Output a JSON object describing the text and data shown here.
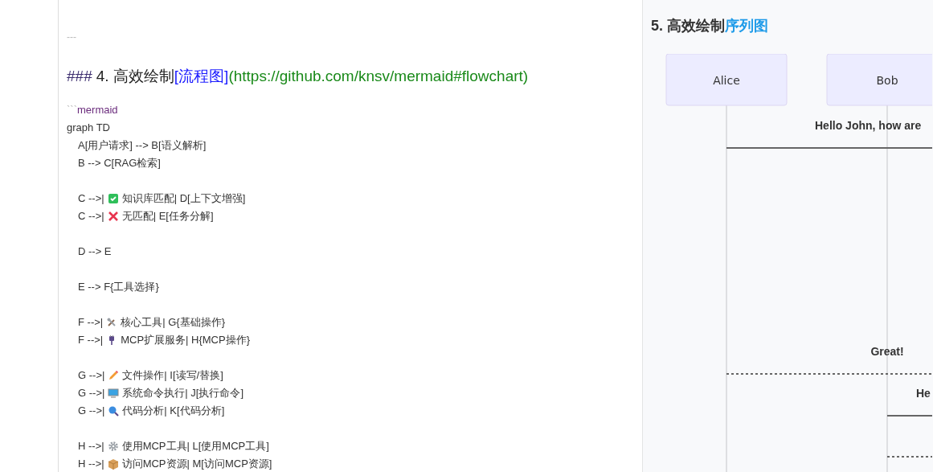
{
  "editor": {
    "rule": "---",
    "heading": {
      "marks": "###",
      "title": "4. 高效绘制",
      "link_text": "[流程图]",
      "link_url": "(https://github.com/knsv/mermaid#flowchart)"
    },
    "fence": {
      "marks": "```",
      "lang": "mermaid"
    },
    "graph_line": "graph TD",
    "blocks": [
      [
        {
          "kind": "text",
          "text": "A[用户请求] --> B[语义解析]"
        },
        {
          "kind": "text",
          "text": "B --> C[RAG检索]"
        }
      ],
      [
        {
          "kind": "check",
          "before": "C -->|",
          "after": "知识库匹配| D[上下文增强]"
        },
        {
          "kind": "cross",
          "before": "C -->|",
          "after": "无匹配| E[任务分解]"
        }
      ],
      [
        {
          "kind": "text",
          "text": "D --> E"
        }
      ],
      [
        {
          "kind": "text",
          "text": "E --> F{工具选择}"
        }
      ],
      [
        {
          "kind": "tools",
          "before": "F -->|",
          "after": "核心工具| G{基础操作}"
        },
        {
          "kind": "plug",
          "before": "F -->|",
          "after": "MCP扩展服务| H{MCP操作}"
        }
      ],
      [
        {
          "kind": "pencil",
          "before": "G -->|",
          "after": "文件操作| I[读写/替换]"
        },
        {
          "kind": "monitor",
          "before": "G -->|",
          "after": "系统命令执行| J[执行命令]"
        },
        {
          "kind": "magnifier",
          "before": "G -->|",
          "after": "代码分析| K[代码分析]"
        }
      ],
      [
        {
          "kind": "gear",
          "before": "H -->|",
          "after": "使用MCP工具| L[使用MCP工具]"
        },
        {
          "kind": "box",
          "before": "H -->|",
          "after": "访问MCP资源| M[访问MCP资源]"
        }
      ]
    ]
  },
  "preview": {
    "heading": {
      "title": "5. 高效绘制",
      "link_text": "序列图"
    },
    "participants": [
      "Alice",
      "Bob"
    ],
    "messages": [
      {
        "text": "Hello John, how are",
        "kind": "solid"
      },
      {
        "text": "Great!",
        "kind": "dotted"
      },
      {
        "text": "He",
        "kind": "solid"
      },
      {
        "kind": "dotted"
      }
    ]
  }
}
